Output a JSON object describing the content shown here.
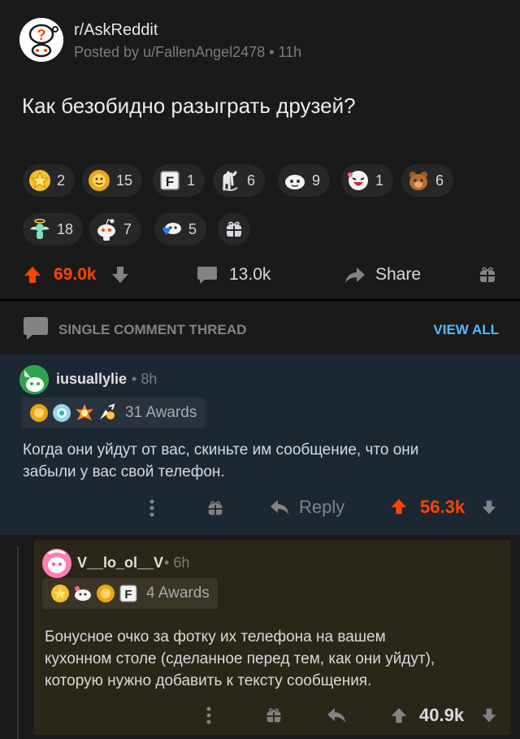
{
  "post": {
    "subreddit": "r/AskReddit",
    "posted_by": "Posted by u/FallenAngel2478",
    "time": "11h",
    "title": "Как безобидно разыграть друзей?",
    "awards_row1": [
      {
        "icon": "silver-star-award-icon",
        "count": "2"
      },
      {
        "icon": "gold-lion-award-icon",
        "count": "15"
      },
      {
        "icon": "press-f-award-icon",
        "count": "1"
      },
      {
        "icon": "clapping-hands-award-icon",
        "count": "6"
      },
      {
        "icon": "snoo-face-award-icon",
        "count": "9"
      },
      {
        "icon": "laughing-face-award-icon",
        "count": "1"
      },
      {
        "icon": "bear-award-icon",
        "count": "6"
      }
    ],
    "awards_row2": [
      {
        "icon": "angel-award-icon",
        "count": "18"
      },
      {
        "icon": "snoo-award-icon",
        "count": "7"
      },
      {
        "icon": "heart-snoo-award-icon",
        "count": "5"
      }
    ],
    "score": "69.0k",
    "comments": "13.0k",
    "share": "Share"
  },
  "thread": {
    "label": "SINGLE COMMENT THREAD",
    "view_all": "VIEW ALL"
  },
  "comment1": {
    "user": "iusuallylie",
    "time": "8h",
    "awards": "31 Awards",
    "body_line1": "Когда они уйдут от вас, скиньте им сообщение, что они",
    "body_line2": "забыли у вас свой телефон.",
    "reply": "Reply",
    "score": "56.3k"
  },
  "comment2": {
    "user": "V__lo_ol__V",
    "time": "6h",
    "awards": "4 Awards",
    "body_line1": "Бонусное очко за фотку их телефона на вашем",
    "body_line2": "кухонном столе (сделанное перед тем, как они уйдут),",
    "body_line3": "которую нужно добавить к тексту сообщения.",
    "score": "40.9k"
  },
  "colors": {
    "upvote": "#ff4500",
    "link": "#4fbcff",
    "comment1_bg": "#1c2734",
    "comment2_bg": "#2b2718"
  }
}
